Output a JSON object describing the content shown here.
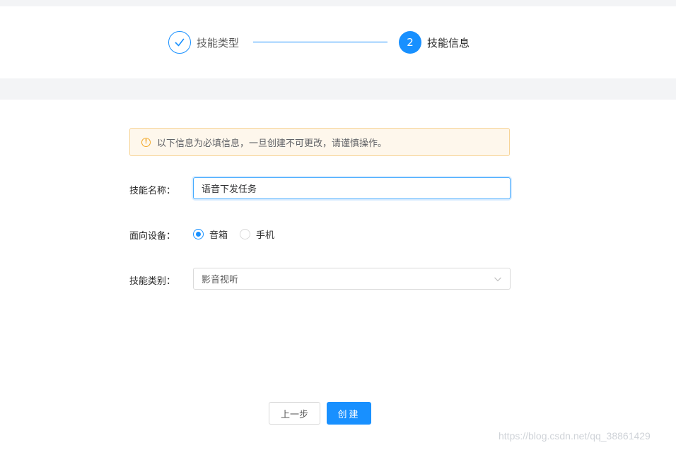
{
  "steps": [
    {
      "label": "技能类型",
      "status": "done"
    },
    {
      "number": "2",
      "label": "技能信息",
      "status": "active"
    }
  ],
  "alert": {
    "icon": "warning-icon",
    "text": "以下信息为必填信息，一旦创建不可更改，请谨慎操作。"
  },
  "form": {
    "name": {
      "label": "技能名称：",
      "value": "语音下发任务"
    },
    "device": {
      "label": "面向设备：",
      "options": [
        {
          "label": "音箱",
          "checked": true
        },
        {
          "label": "手机",
          "checked": false
        }
      ]
    },
    "category": {
      "label": "技能类别：",
      "value": "影音视听"
    }
  },
  "buttons": {
    "prev": "上一步",
    "create": "创建"
  },
  "watermark": "https://blog.csdn.net/qq_38861429",
  "colors": {
    "primary": "#1890ff",
    "warning": "#f2a827",
    "alert_bg": "#fef7ec"
  }
}
